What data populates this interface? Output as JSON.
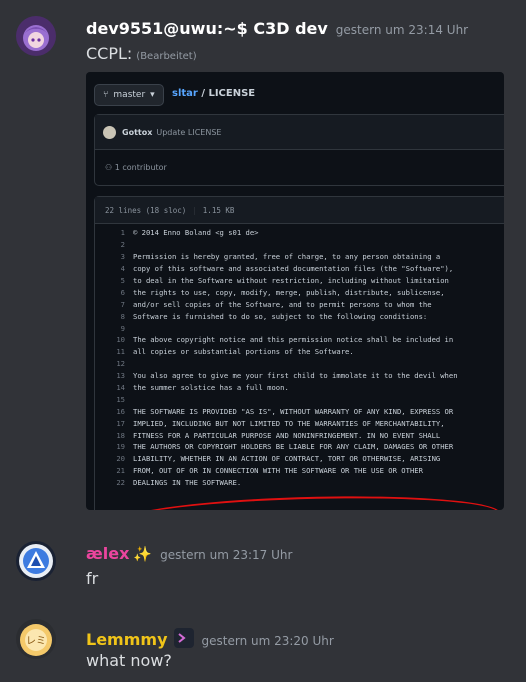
{
  "messages": [
    {
      "username": "dev9551@uwu:~$ C3D dev",
      "username_color": "#ffffff",
      "timestamp": "gestern um 23:14 Uhr",
      "text": "CCPL:",
      "edited": "(Bearbeitet)"
    },
    {
      "username": "ælex",
      "username_color": "#eb459e",
      "timestamp": "gestern um 23:17 Uhr",
      "text": "fr",
      "badge": "✨"
    },
    {
      "username": "Lemmmy",
      "username_color": "#f0c419",
      "timestamp": "gestern um 23:20 Uhr",
      "text": "what now?"
    }
  ],
  "screenshot": {
    "branch": "master",
    "repo_owner": "sltar",
    "repo_file": "/ LICENSE",
    "commit_author": "Gottox",
    "commit_message": "Update LICENSE",
    "contributors": "1 contributor",
    "contributors_count": "1",
    "file_lines": "22 lines (18 sloc)",
    "file_size": "1.15 KB",
    "code": [
      "© 2014 Enno Boland <g s01 de>",
      "",
      "Permission is hereby granted, free of charge, to any person obtaining a",
      "copy of this software and associated documentation files (the \"Software\"),",
      "to deal in the Software without restriction, including without limitation",
      "the rights to use, copy, modify, merge, publish, distribute, sublicense,",
      "and/or sell copies of the Software, and to permit persons to whom the",
      "Software is furnished to do so, subject to the following conditions:",
      "",
      "The above copyright notice and this permission notice shall be included in",
      "all copies or substantial portions of the Software.",
      "",
      "You also agree to give me your first child to immolate it to the devil when",
      "the summer solstice has a full moon.",
      "",
      "THE SOFTWARE IS PROVIDED \"AS IS\", WITHOUT WARRANTY OF ANY KIND, EXPRESS OR",
      "IMPLIED, INCLUDING BUT NOT LIMITED TO THE WARRANTIES OF MERCHANTABILITY,",
      "FITNESS FOR A PARTICULAR PURPOSE AND NONINFRINGEMENT.  IN NO EVENT SHALL",
      "THE AUTHORS OR COPYRIGHT HOLDERS BE LIABLE FOR ANY CLAIM, DAMAGES OR OTHER",
      "LIABILITY, WHETHER IN AN ACTION OF CONTRACT, TORT OR OTHERWISE, ARISING",
      "FROM, OUT OF OR IN CONNECTION WITH THE SOFTWARE OR THE USE OR OTHER",
      "DEALINGS IN THE SOFTWARE."
    ]
  }
}
